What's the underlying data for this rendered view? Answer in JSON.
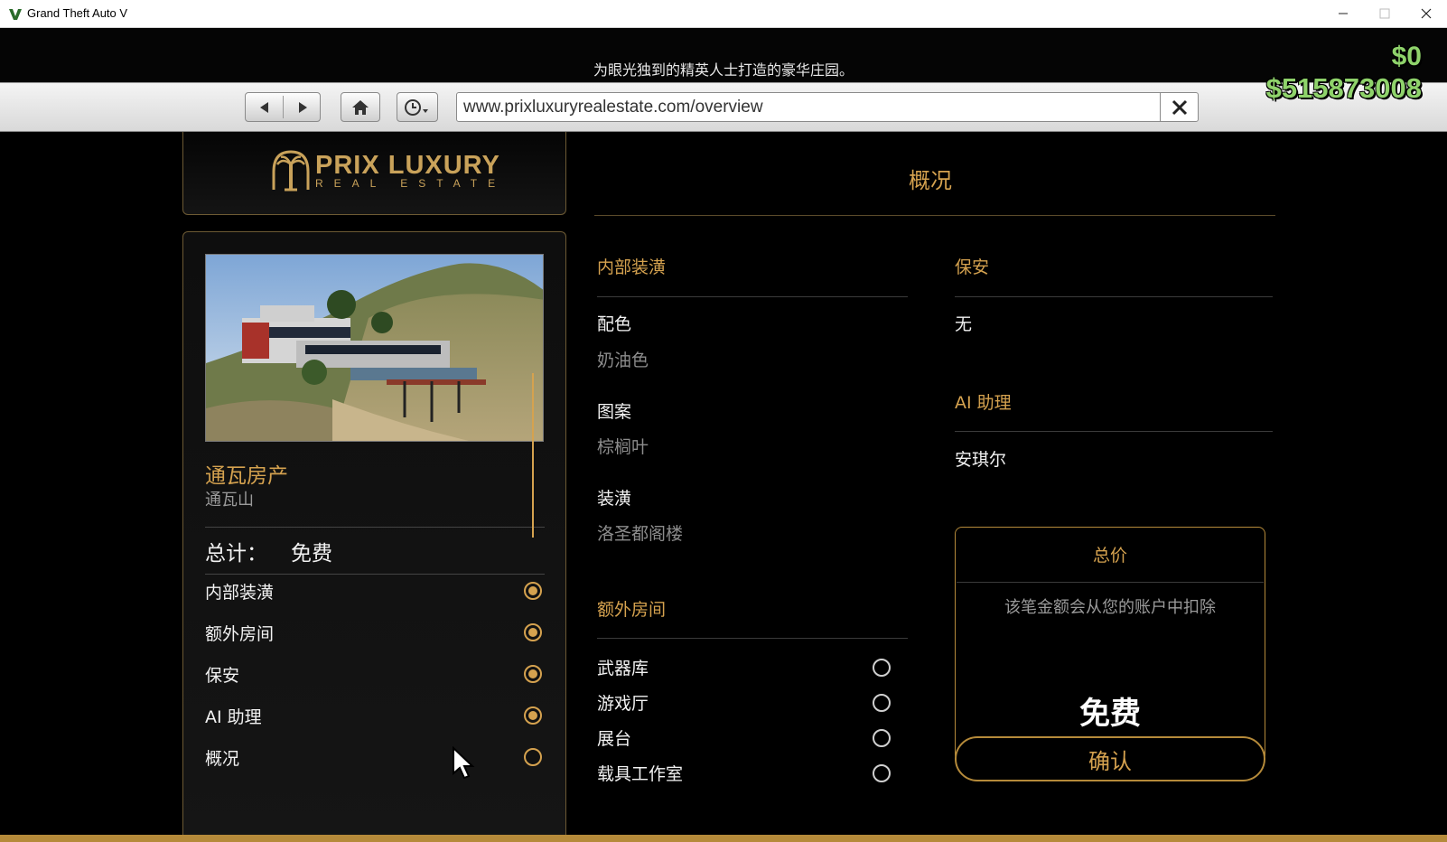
{
  "window": {
    "title": "Grand Theft Auto V"
  },
  "hud": {
    "tagline": "为眼光独到的精英人士打造的豪华庄园。",
    "cash": "$0",
    "bank": "$515873008"
  },
  "browser": {
    "url": "www.prixluxuryrealestate.com/overview"
  },
  "logo": {
    "main": "PRIX LUXURY",
    "sub": "REAL ESTATE"
  },
  "property": {
    "name": "通瓦房产",
    "location": "通瓦山",
    "total_label": "总计：",
    "total_value": "免费"
  },
  "steps": [
    {
      "label": "内部装潢",
      "done": true
    },
    {
      "label": "额外房间",
      "done": true
    },
    {
      "label": "保安",
      "done": true
    },
    {
      "label": "AI 助理",
      "done": true
    },
    {
      "label": "概况",
      "done": false
    }
  ],
  "overview": {
    "title": "概况",
    "interior": {
      "title": "内部装潢",
      "color_label": "配色",
      "color_value": "奶油色",
      "pattern_label": "图案",
      "pattern_value": "棕榈叶",
      "decor_label": "装潢",
      "decor_value": "洛圣都阁楼"
    },
    "extra_rooms": {
      "title": "额外房间",
      "items": [
        "武器库",
        "游戏厅",
        "展台",
        "载具工作室"
      ]
    },
    "security": {
      "title": "保安",
      "value": "无"
    },
    "ai": {
      "title": "AI 助理",
      "value": "安琪尔"
    },
    "price": {
      "title": "总价",
      "note": "该笔金额会从您的账户中扣除",
      "value": "免费"
    },
    "confirm_label": "确认"
  },
  "colors": {
    "gold": "#d5a24f",
    "money_green": "#8fd36b"
  }
}
